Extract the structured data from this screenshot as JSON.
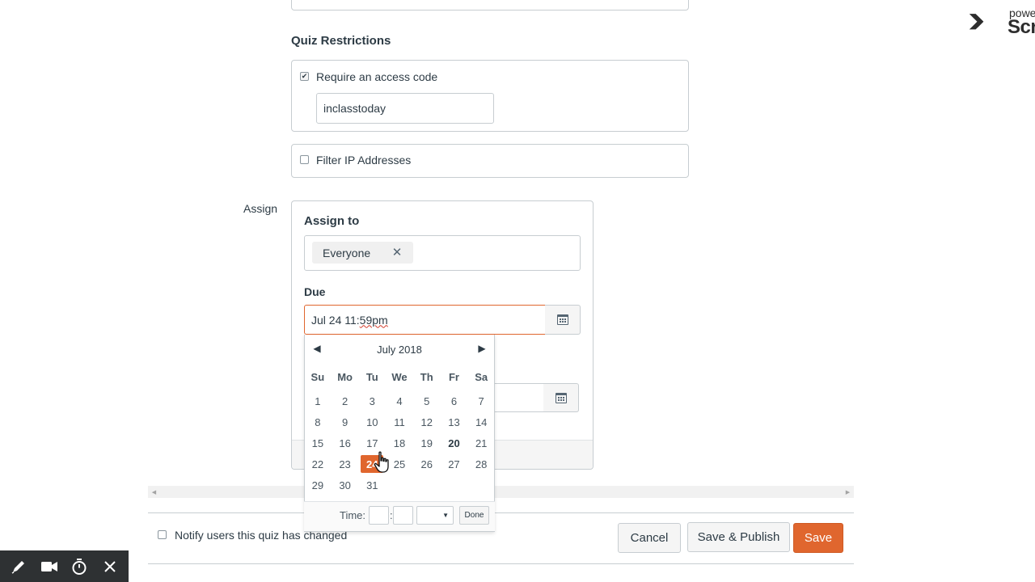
{
  "quiz_restrictions": {
    "title": "Quiz Restrictions",
    "access_code": {
      "checked": true,
      "label": "Require an access code",
      "value": "inclasstoday"
    },
    "filter_ip": {
      "checked": false,
      "label": "Filter IP Addresses"
    }
  },
  "assign": {
    "side_label": "Assign",
    "assign_to_title": "Assign to",
    "token": "Everyone",
    "due_label": "Due",
    "due_value_prefix": "Jul 24 11:",
    "due_value_misspelled": "59pm"
  },
  "datepicker": {
    "month_title": "July 2018",
    "days_of_week": [
      "Su",
      "Mo",
      "Tu",
      "We",
      "Th",
      "Fr",
      "Sa"
    ],
    "weeks": [
      [
        "1",
        "2",
        "3",
        "4",
        "5",
        "6",
        "7"
      ],
      [
        "8",
        "9",
        "10",
        "11",
        "12",
        "13",
        "14"
      ],
      [
        "15",
        "16",
        "17",
        "18",
        "19",
        "20",
        "21"
      ],
      [
        "22",
        "23",
        "24",
        "25",
        "26",
        "27",
        "28"
      ],
      [
        "29",
        "30",
        "31",
        "",
        "",
        "",
        ""
      ]
    ],
    "today": "20",
    "selected": "24",
    "time_label": "Time:",
    "time_separator": ":",
    "done_label": "Done"
  },
  "footer": {
    "notify_label": "Notify users this quiz has changed",
    "notify_checked": false,
    "cancel_label": "Cancel",
    "save_publish_label": "Save & Publish",
    "save_label": "Save"
  },
  "overlay": {
    "logo_top": "powe",
    "logo_bottom": "Scr"
  },
  "colors": {
    "accent": "#e0662e",
    "text": "#2d3b45",
    "border": "#c7cdd1",
    "toolbar_bg": "#2e3133"
  }
}
